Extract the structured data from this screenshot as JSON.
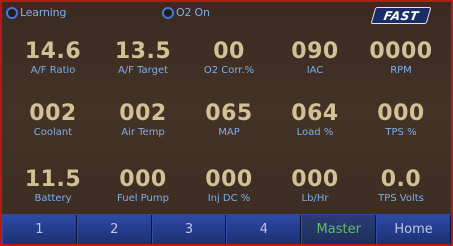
{
  "indicators": {
    "learning": "Learning",
    "o2_on": "O2 On"
  },
  "logo": "FAST",
  "gauges": [
    {
      "value": "14.6",
      "label": "A/F Ratio"
    },
    {
      "value": "13.5",
      "label": "A/F Target"
    },
    {
      "value": "00",
      "label": "O2 Corr.%"
    },
    {
      "value": "090",
      "label": "IAC"
    },
    {
      "value": "0000",
      "label": "RPM"
    },
    {
      "value": "002",
      "label": "Coolant"
    },
    {
      "value": "002",
      "label": "Air Temp"
    },
    {
      "value": "065",
      "label": "MAP"
    },
    {
      "value": "064",
      "label": "Load %"
    },
    {
      "value": "000",
      "label": "TPS %"
    },
    {
      "value": "11.5",
      "label": "Battery"
    },
    {
      "value": "000",
      "label": "Fuel Pump"
    },
    {
      "value": "000",
      "label": "Inj DC %"
    },
    {
      "value": "000",
      "label": "Lb/Hr"
    },
    {
      "value": "0.0",
      "label": "TPS Volts"
    }
  ],
  "nav": [
    {
      "label": "1"
    },
    {
      "label": "2"
    },
    {
      "label": "3"
    },
    {
      "label": "4"
    },
    {
      "label": "Master"
    },
    {
      "label": "Home"
    }
  ],
  "colors": {
    "frame_border": "#b31b15",
    "value_text": "#d1c296",
    "label_text": "#7ab0ea",
    "indicator_ring": "#3f78d8",
    "nav_button": "#233a86",
    "nav_active_text": "#5fbb6a"
  }
}
